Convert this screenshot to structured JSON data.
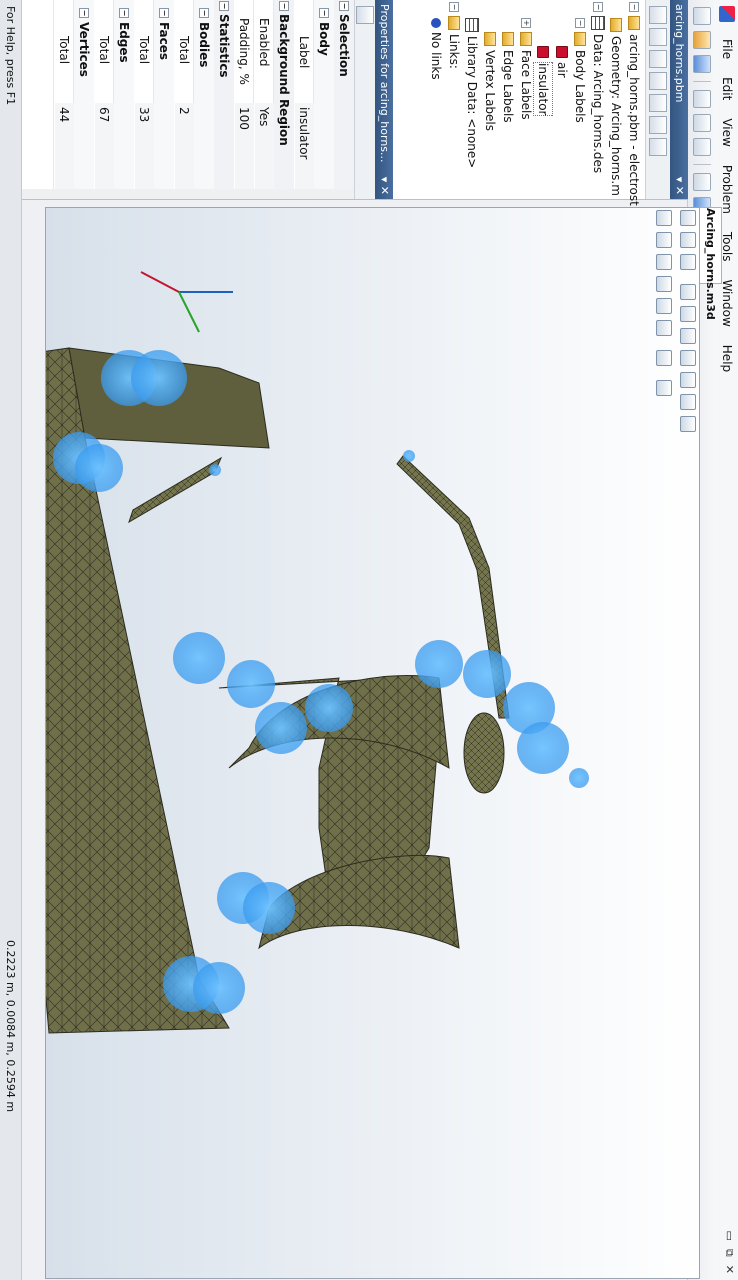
{
  "menubar": {
    "items": [
      "File",
      "Edit",
      "View",
      "Problem",
      "Tools",
      "Window",
      "Help"
    ]
  },
  "explorer": {
    "title": "arcing_horns.pbm",
    "tree": {
      "root": "arcing_horns.pbm - electrost",
      "geometry": "Geometry: Arcing_horns.m",
      "data": "Data: Arcing_horns.des",
      "body_labels": "Body Labels",
      "air": "air",
      "insulator": "insulator",
      "face_labels": "Face Labels",
      "edge_labels": "Edge Labels",
      "vertex_labels": "Vertex Labels",
      "library": "Library Data: <none>",
      "links": "Links:",
      "no_links": "No links"
    }
  },
  "properties": {
    "title": "Properties for arcing_horns...",
    "rows": [
      {
        "type": "cat",
        "key": "Selection"
      },
      {
        "type": "cat2",
        "key": "Body"
      },
      {
        "type": "row",
        "key": "Label",
        "value": "insulator"
      },
      {
        "type": "cat",
        "key": "Background Region"
      },
      {
        "type": "row",
        "key": "Enabled",
        "value": "Yes"
      },
      {
        "type": "row",
        "key": "Padding, %",
        "value": "100"
      },
      {
        "type": "cat",
        "key": "Statistics"
      },
      {
        "type": "cat2",
        "key": "Bodies"
      },
      {
        "type": "sub",
        "key": "Total",
        "value": "2"
      },
      {
        "type": "cat2",
        "key": "Faces"
      },
      {
        "type": "sub",
        "key": "Total",
        "value": "33"
      },
      {
        "type": "cat2",
        "key": "Edges"
      },
      {
        "type": "sub",
        "key": "Total",
        "value": "67"
      },
      {
        "type": "cat2",
        "key": "Vertices"
      },
      {
        "type": "sub",
        "key": "Total",
        "value": "44"
      }
    ]
  },
  "document": {
    "tab": "Arcing_horns.m3d"
  },
  "status": {
    "help": "For Help, press F1",
    "coords": "0.2223 m, 0.0084 m, 0.2594 m"
  },
  "colors": {
    "model": "#6f6f4a",
    "highlight": "#4aa8f0",
    "mesh_line": "#2c2c20"
  }
}
